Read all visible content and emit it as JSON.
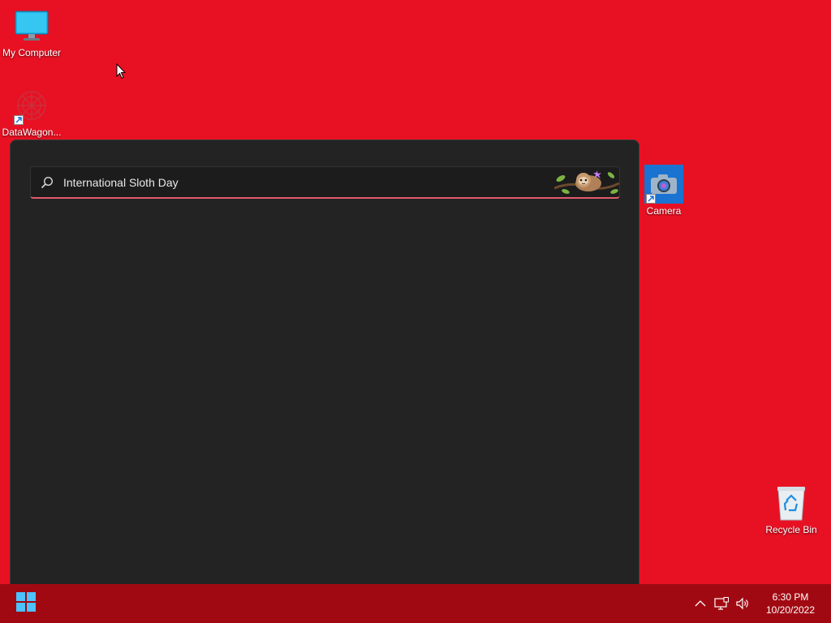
{
  "desktop": {
    "icons": [
      {
        "label": "My Computer"
      },
      {
        "label": "DataWagon..."
      },
      {
        "label": "Camera"
      },
      {
        "label": "Recycle Bin"
      }
    ]
  },
  "search": {
    "value": "International Sloth Day",
    "icon": "search-icon",
    "highlight_icon": "sloth-illustration"
  },
  "taskbar": {
    "start_icon": "windows-logo-icon",
    "tray": {
      "overflow_icon": "chevron-up-icon",
      "network_icon": "network-icon",
      "volume_icon": "speaker-icon"
    },
    "clock": {
      "time": "6:30 PM",
      "date": "10/20/2022"
    }
  },
  "colors": {
    "desktop_bg": "#e81123",
    "taskbar_bg": "#a10912",
    "panel_bg": "#232323",
    "search_accent": "#e05a6b"
  }
}
